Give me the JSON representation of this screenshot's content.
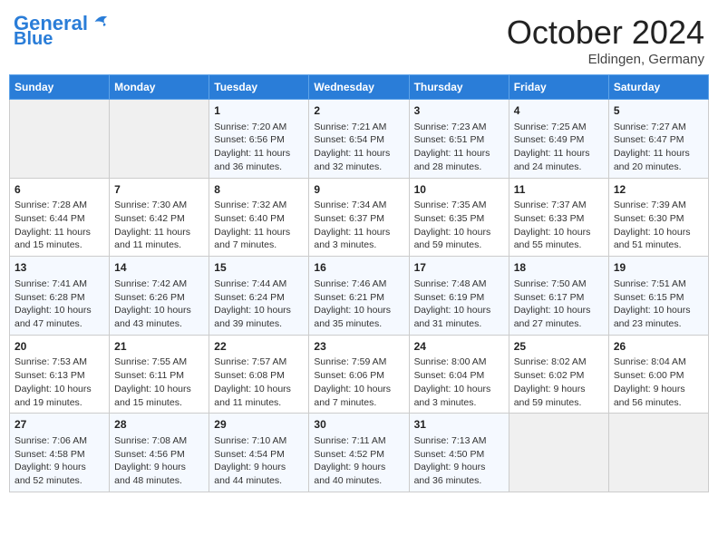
{
  "header": {
    "logo_line1": "General",
    "logo_line2": "Blue",
    "month": "October 2024",
    "location": "Eldingen, Germany"
  },
  "days_of_week": [
    "Sunday",
    "Monday",
    "Tuesday",
    "Wednesday",
    "Thursday",
    "Friday",
    "Saturday"
  ],
  "weeks": [
    [
      {
        "day": "",
        "empty": true
      },
      {
        "day": "",
        "empty": true
      },
      {
        "day": "1",
        "sunrise": "Sunrise: 7:20 AM",
        "sunset": "Sunset: 6:56 PM",
        "daylight": "Daylight: 11 hours and 36 minutes."
      },
      {
        "day": "2",
        "sunrise": "Sunrise: 7:21 AM",
        "sunset": "Sunset: 6:54 PM",
        "daylight": "Daylight: 11 hours and 32 minutes."
      },
      {
        "day": "3",
        "sunrise": "Sunrise: 7:23 AM",
        "sunset": "Sunset: 6:51 PM",
        "daylight": "Daylight: 11 hours and 28 minutes."
      },
      {
        "day": "4",
        "sunrise": "Sunrise: 7:25 AM",
        "sunset": "Sunset: 6:49 PM",
        "daylight": "Daylight: 11 hours and 24 minutes."
      },
      {
        "day": "5",
        "sunrise": "Sunrise: 7:27 AM",
        "sunset": "Sunset: 6:47 PM",
        "daylight": "Daylight: 11 hours and 20 minutes."
      }
    ],
    [
      {
        "day": "6",
        "sunrise": "Sunrise: 7:28 AM",
        "sunset": "Sunset: 6:44 PM",
        "daylight": "Daylight: 11 hours and 15 minutes."
      },
      {
        "day": "7",
        "sunrise": "Sunrise: 7:30 AM",
        "sunset": "Sunset: 6:42 PM",
        "daylight": "Daylight: 11 hours and 11 minutes."
      },
      {
        "day": "8",
        "sunrise": "Sunrise: 7:32 AM",
        "sunset": "Sunset: 6:40 PM",
        "daylight": "Daylight: 11 hours and 7 minutes."
      },
      {
        "day": "9",
        "sunrise": "Sunrise: 7:34 AM",
        "sunset": "Sunset: 6:37 PM",
        "daylight": "Daylight: 11 hours and 3 minutes."
      },
      {
        "day": "10",
        "sunrise": "Sunrise: 7:35 AM",
        "sunset": "Sunset: 6:35 PM",
        "daylight": "Daylight: 10 hours and 59 minutes."
      },
      {
        "day": "11",
        "sunrise": "Sunrise: 7:37 AM",
        "sunset": "Sunset: 6:33 PM",
        "daylight": "Daylight: 10 hours and 55 minutes."
      },
      {
        "day": "12",
        "sunrise": "Sunrise: 7:39 AM",
        "sunset": "Sunset: 6:30 PM",
        "daylight": "Daylight: 10 hours and 51 minutes."
      }
    ],
    [
      {
        "day": "13",
        "sunrise": "Sunrise: 7:41 AM",
        "sunset": "Sunset: 6:28 PM",
        "daylight": "Daylight: 10 hours and 47 minutes."
      },
      {
        "day": "14",
        "sunrise": "Sunrise: 7:42 AM",
        "sunset": "Sunset: 6:26 PM",
        "daylight": "Daylight: 10 hours and 43 minutes."
      },
      {
        "day": "15",
        "sunrise": "Sunrise: 7:44 AM",
        "sunset": "Sunset: 6:24 PM",
        "daylight": "Daylight: 10 hours and 39 minutes."
      },
      {
        "day": "16",
        "sunrise": "Sunrise: 7:46 AM",
        "sunset": "Sunset: 6:21 PM",
        "daylight": "Daylight: 10 hours and 35 minutes."
      },
      {
        "day": "17",
        "sunrise": "Sunrise: 7:48 AM",
        "sunset": "Sunset: 6:19 PM",
        "daylight": "Daylight: 10 hours and 31 minutes."
      },
      {
        "day": "18",
        "sunrise": "Sunrise: 7:50 AM",
        "sunset": "Sunset: 6:17 PM",
        "daylight": "Daylight: 10 hours and 27 minutes."
      },
      {
        "day": "19",
        "sunrise": "Sunrise: 7:51 AM",
        "sunset": "Sunset: 6:15 PM",
        "daylight": "Daylight: 10 hours and 23 minutes."
      }
    ],
    [
      {
        "day": "20",
        "sunrise": "Sunrise: 7:53 AM",
        "sunset": "Sunset: 6:13 PM",
        "daylight": "Daylight: 10 hours and 19 minutes."
      },
      {
        "day": "21",
        "sunrise": "Sunrise: 7:55 AM",
        "sunset": "Sunset: 6:11 PM",
        "daylight": "Daylight: 10 hours and 15 minutes."
      },
      {
        "day": "22",
        "sunrise": "Sunrise: 7:57 AM",
        "sunset": "Sunset: 6:08 PM",
        "daylight": "Daylight: 10 hours and 11 minutes."
      },
      {
        "day": "23",
        "sunrise": "Sunrise: 7:59 AM",
        "sunset": "Sunset: 6:06 PM",
        "daylight": "Daylight: 10 hours and 7 minutes."
      },
      {
        "day": "24",
        "sunrise": "Sunrise: 8:00 AM",
        "sunset": "Sunset: 6:04 PM",
        "daylight": "Daylight: 10 hours and 3 minutes."
      },
      {
        "day": "25",
        "sunrise": "Sunrise: 8:02 AM",
        "sunset": "Sunset: 6:02 PM",
        "daylight": "Daylight: 9 hours and 59 minutes."
      },
      {
        "day": "26",
        "sunrise": "Sunrise: 8:04 AM",
        "sunset": "Sunset: 6:00 PM",
        "daylight": "Daylight: 9 hours and 56 minutes."
      }
    ],
    [
      {
        "day": "27",
        "sunrise": "Sunrise: 7:06 AM",
        "sunset": "Sunset: 4:58 PM",
        "daylight": "Daylight: 9 hours and 52 minutes."
      },
      {
        "day": "28",
        "sunrise": "Sunrise: 7:08 AM",
        "sunset": "Sunset: 4:56 PM",
        "daylight": "Daylight: 9 hours and 48 minutes."
      },
      {
        "day": "29",
        "sunrise": "Sunrise: 7:10 AM",
        "sunset": "Sunset: 4:54 PM",
        "daylight": "Daylight: 9 hours and 44 minutes."
      },
      {
        "day": "30",
        "sunrise": "Sunrise: 7:11 AM",
        "sunset": "Sunset: 4:52 PM",
        "daylight": "Daylight: 9 hours and 40 minutes."
      },
      {
        "day": "31",
        "sunrise": "Sunrise: 7:13 AM",
        "sunset": "Sunset: 4:50 PM",
        "daylight": "Daylight: 9 hours and 36 minutes."
      },
      {
        "day": "",
        "empty": true
      },
      {
        "day": "",
        "empty": true
      }
    ]
  ]
}
